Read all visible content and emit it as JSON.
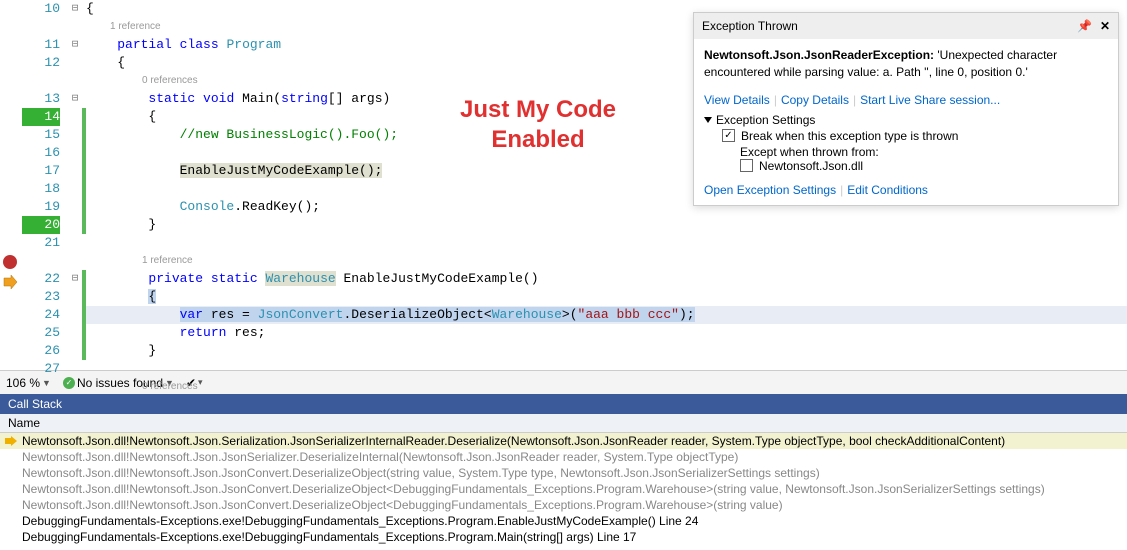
{
  "overlay": "Just My Code\nEnabled",
  "zoom": "106 %",
  "issues": "No issues found",
  "codelens": {
    "ref1": "1 reference",
    "ref0": "0 references"
  },
  "lines": {
    "n10": "10",
    "n11": "11",
    "n12": "12",
    "n13": "13",
    "n14": "14",
    "n15": "15",
    "n16": "16",
    "n17": "17",
    "n18": "18",
    "n19": "19",
    "n20": "20",
    "n21": "21",
    "n22": "22",
    "n23": "23",
    "n24": "24",
    "n25": "25",
    "n26": "26",
    "n27": "27"
  },
  "code": {
    "l10": "{",
    "l11a": "partial",
    "l11b": "class",
    "l11c": "Program",
    "l12": "{",
    "l13a": "static",
    "l13b": "void",
    "l13c": "Main(",
    "l13d": "string",
    "l13e": "[] args)",
    "l14": "{",
    "l15": "//new BusinessLogic().Foo();",
    "l17": "EnableJustMyCodeExample();",
    "l19a": "Console",
    "l19b": ".ReadKey();",
    "l20": "}",
    "l22a": "private",
    "l22b": "static",
    "l22c": "Warehouse",
    "l22d": " EnableJustMyCodeExample()",
    "l23": "{",
    "l24a": "var",
    "l24b": " res = ",
    "l24c": "JsonConvert",
    "l24d": ".DeserializeObject<",
    "l24e": "Warehouse",
    "l24f": ">(",
    "l24g": "\"aaa bbb ccc\"",
    "l24h": ");",
    "l25a": "return",
    "l25b": " res;",
    "l26": "}"
  },
  "exception": {
    "title": "Exception Thrown",
    "type": "Newtonsoft.Json.JsonReaderException:",
    "msg": " 'Unexpected character encountered while parsing value: a. Path '', line 0, position 0.'",
    "viewDetails": "View Details",
    "copyDetails": "Copy Details",
    "liveShare": "Start Live Share session...",
    "settingsHeader": "Exception Settings",
    "breakWhen": "Break when this exception type is thrown",
    "exceptWhen": "Except when thrown from:",
    "dll": "Newtonsoft.Json.dll",
    "openSettings": "Open Exception Settings",
    "editConditions": "Edit Conditions"
  },
  "callstack": {
    "title": "Call Stack",
    "header": "Name",
    "rows": [
      "Newtonsoft.Json.dll!Newtonsoft.Json.Serialization.JsonSerializerInternalReader.Deserialize(Newtonsoft.Json.JsonReader reader, System.Type objectType, bool checkAdditionalContent)",
      "Newtonsoft.Json.dll!Newtonsoft.Json.JsonSerializer.DeserializeInternal(Newtonsoft.Json.JsonReader reader, System.Type objectType)",
      "Newtonsoft.Json.dll!Newtonsoft.Json.JsonConvert.DeserializeObject(string value, System.Type type, Newtonsoft.Json.JsonSerializerSettings settings)",
      "Newtonsoft.Json.dll!Newtonsoft.Json.JsonConvert.DeserializeObject<DebuggingFundamentals_Exceptions.Program.Warehouse>(string value, Newtonsoft.Json.JsonSerializerSettings settings)",
      "Newtonsoft.Json.dll!Newtonsoft.Json.JsonConvert.DeserializeObject<DebuggingFundamentals_Exceptions.Program.Warehouse>(string value)",
      "DebuggingFundamentals-Exceptions.exe!DebuggingFundamentals_Exceptions.Program.EnableJustMyCodeExample() Line 24",
      "DebuggingFundamentals-Exceptions.exe!DebuggingFundamentals_Exceptions.Program.Main(string[] args) Line 17"
    ]
  }
}
